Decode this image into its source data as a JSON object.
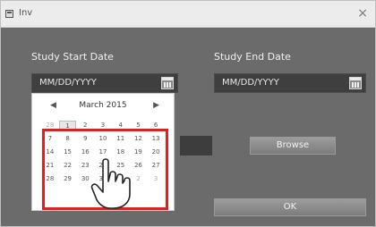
{
  "window": {
    "title": "Inv",
    "close_glyph": "×"
  },
  "start": {
    "label": "Study Start Date",
    "value": "MM/DD/YYYY",
    "icon": "calendar-icon"
  },
  "end": {
    "label": "Study End Date",
    "value": "MM/DD/YYYY",
    "icon": "calendar-icon"
  },
  "browse_button": {
    "label": "Browse"
  },
  "ok_button": {
    "label": "OK"
  },
  "calendar": {
    "prev": "◀",
    "next": "▶",
    "month": "March 2015",
    "days": [
      "28",
      "1",
      "2",
      "3",
      "4",
      "5",
      "6",
      "7",
      "8",
      "9",
      "10",
      "11",
      "12",
      "13",
      "14",
      "15",
      "16",
      "17",
      "18",
      "19",
      "20",
      "21",
      "22",
      "23",
      "24",
      "25",
      "26",
      "27",
      "28",
      "29",
      "30",
      "31",
      "1",
      "2",
      "3"
    ]
  },
  "highlight_color": "#e02020"
}
